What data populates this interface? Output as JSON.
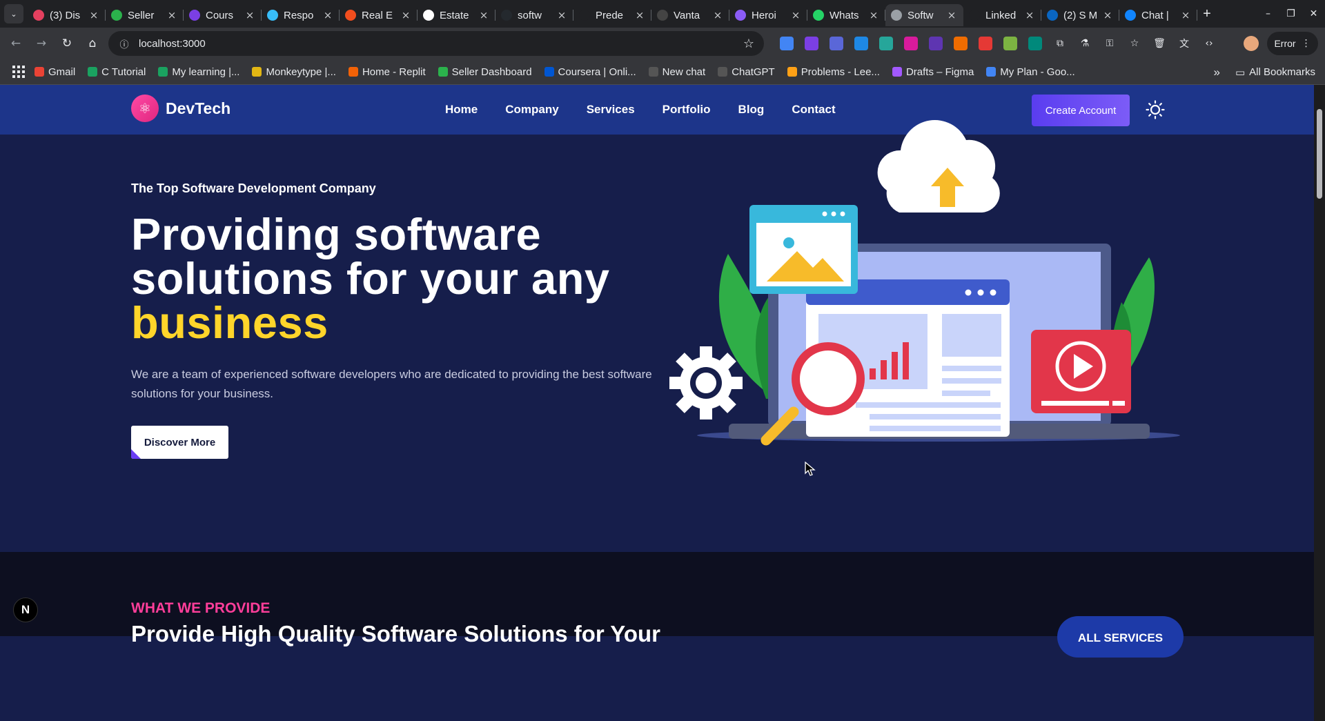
{
  "browser": {
    "tabs": [
      {
        "label": "(3) Dis",
        "icon": "ig-icon",
        "color": "#e4405f"
      },
      {
        "label": "Seller",
        "icon": "seller-icon",
        "color": "#2bb24c"
      },
      {
        "label": "Cours",
        "icon": "course-icon",
        "color": "#7b3fe4"
      },
      {
        "label": "Respo",
        "icon": "tailwind-icon",
        "color": "#38bdf8"
      },
      {
        "label": "Real E",
        "icon": "figma-icon",
        "color": "#f24e1e"
      },
      {
        "label": "Estate",
        "icon": "vercel-icon",
        "color": "#ffffff"
      },
      {
        "label": "softw",
        "icon": "github-icon",
        "color": "#24292e"
      },
      {
        "label": "Prede",
        "icon": "blank-icon",
        "color": "#202124"
      },
      {
        "label": "Vanta",
        "icon": "vanta-icon",
        "color": "#444"
      },
      {
        "label": "Heroi",
        "icon": "shield-icon",
        "color": "#8b5cf6"
      },
      {
        "label": "Whats",
        "icon": "whatsapp-icon",
        "color": "#25d366"
      },
      {
        "label": "Softw",
        "icon": "globe-icon",
        "color": "#9aa0a6",
        "active": true
      },
      {
        "label": "Linked",
        "icon": "blank-icon",
        "color": "#202124"
      },
      {
        "label": "(2) S M",
        "icon": "linkedin-icon",
        "color": "#0a66c2"
      },
      {
        "label": "Chat |",
        "icon": "bluesky-icon",
        "color": "#1185fe"
      }
    ],
    "url": "localhost:3000",
    "error_label": "Error",
    "bookmarks": [
      {
        "label": "Gmail",
        "color": "#ea4335"
      },
      {
        "label": "C Tutorial",
        "color": "#1aa260"
      },
      {
        "label": "My learning |...",
        "color": "#1aa260"
      },
      {
        "label": "Monkeytype |...",
        "color": "#e2b714"
      },
      {
        "label": "Home - Replit",
        "color": "#f26207"
      },
      {
        "label": "Seller Dashboard",
        "color": "#2bb24c"
      },
      {
        "label": "Coursera | Onli...",
        "color": "#0056d2"
      },
      {
        "label": "New chat",
        "color": "#555"
      },
      {
        "label": "ChatGPT",
        "color": "#555"
      },
      {
        "label": "Problems - Lee...",
        "color": "#ffa116"
      },
      {
        "label": "Drafts – Figma",
        "color": "#a259ff"
      },
      {
        "label": "My Plan - Goo...",
        "color": "#4285f4"
      }
    ],
    "all_bookmarks": "All Bookmarks",
    "more_bookmarks": "»"
  },
  "site": {
    "brand": "DevTech",
    "nav": [
      "Home",
      "Company",
      "Services",
      "Portfolio",
      "Blog",
      "Contact"
    ],
    "cta": "Create Account",
    "hero": {
      "eyebrow": "The Top Software Development Company",
      "title_line1": "Providing software",
      "title_line2": "solutions for your any",
      "title_highlight": "business",
      "description": "We are a team of experienced software developers who are dedicated to providing the best software solutions for your business.",
      "button": "Discover More"
    },
    "section2": {
      "eyebrow": "WHAT WE PROVIDE",
      "title": "Provide High Quality Software Solutions for Your",
      "button": "ALL SERVICES"
    },
    "dev_badge": "N"
  },
  "colors": {
    "nav_bg": "#1d358a",
    "hero_bg": "#161e4b",
    "highlight": "#ffd52a",
    "accent_pink": "#ff3e9a",
    "cta": "#6a4cf5"
  }
}
